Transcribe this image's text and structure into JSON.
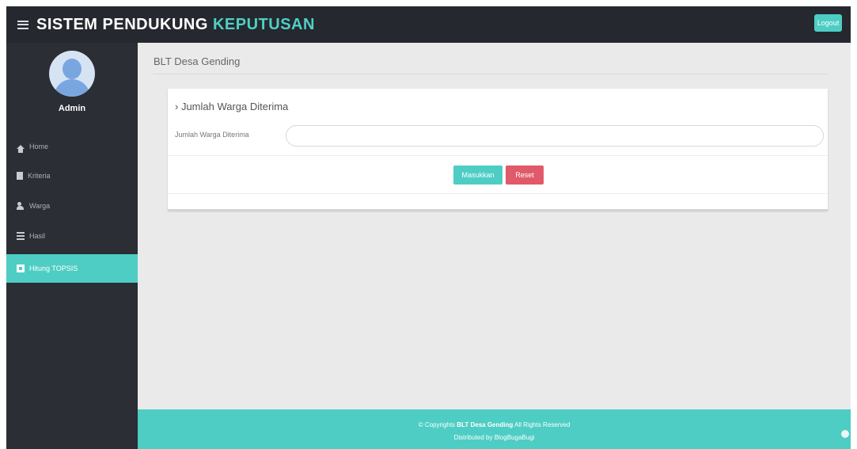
{
  "header": {
    "brand_main": "SISTEM PENDUKUNG",
    "brand_accent": "KEPUTUSAN",
    "logout_label": "Logout"
  },
  "sidebar": {
    "user_name": "Admin",
    "items": [
      {
        "label": "Home",
        "icon": "home-icon",
        "active": false
      },
      {
        "label": "Kriteria",
        "icon": "file-icon",
        "active": false
      },
      {
        "label": "Warga",
        "icon": "users-icon",
        "active": false
      },
      {
        "label": "Hasil",
        "icon": "list-icon",
        "active": false
      },
      {
        "label": "Hitung TOPSIS",
        "icon": "table-icon",
        "active": true
      }
    ]
  },
  "main": {
    "page_title": "BLT Desa Gending",
    "card_title": "› Jumlah Warga Diterima",
    "field_label": "Jumlah Warga Diterima",
    "field_value": "",
    "save_label": "Masukkan",
    "reset_label": "Reset"
  },
  "footer": {
    "copyright_prefix": "© Copyrights",
    "copyright_brand": "BLT Desa Gending",
    "copyright_suffix": "All Rights Reserved",
    "credit": "Distributed by BlogBugaBugi"
  },
  "colors": {
    "accent": "#4ecdc4",
    "danger": "#e05a6a",
    "topbar": "#25282e",
    "sidebar": "#2b2e34",
    "content_bg": "#eaeaea"
  }
}
